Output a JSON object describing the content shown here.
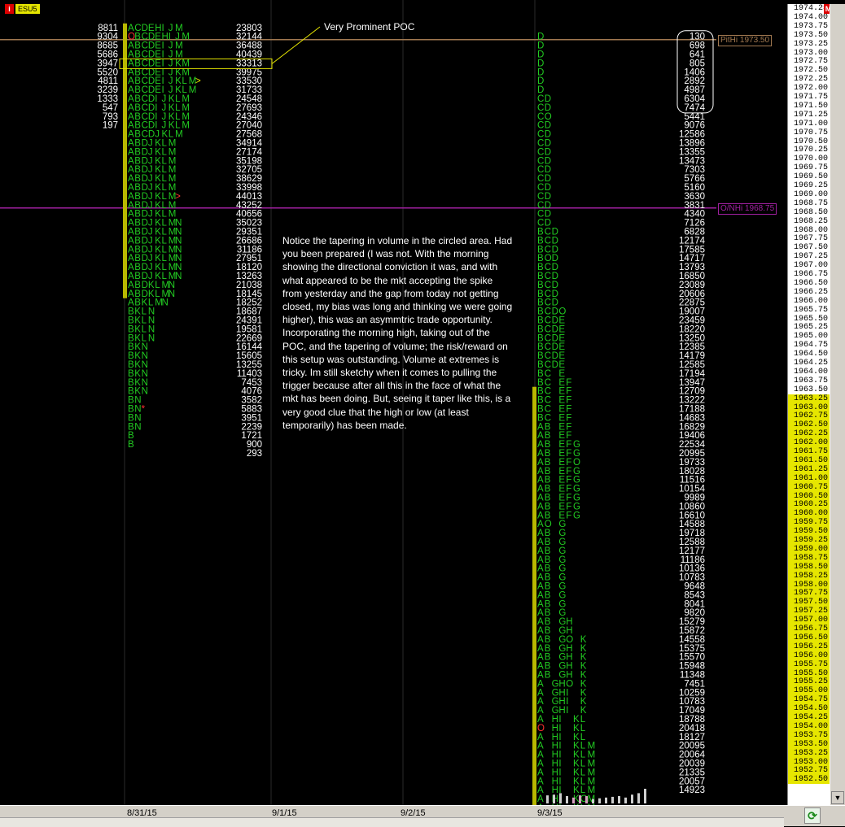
{
  "symbol": {
    "label": "ESU5"
  },
  "annotations": {
    "poc_callout": "Very Prominent POC",
    "note": "Notice the tapering in volume in the circled area. Had you been prepared (I was not. With the morning showing the directional conviction it was, and with what appeared to be the mkt accepting the spike from yesterday and the gap from today not getting closed, my bias was long and thinking we were going higher), this was an asymmtric trade opportunity. Incorporating the morning high, taking out of the POC, and the tapering of volume; the risk/reward on this setup was outstanding. Volume at extremes is tricky. Im still sketchy when it comes to pulling the trigger because after all this in the face of what the mkt has been doing. But, seeing it taper like this, is a very good clue that the high or low (at least temporarily) has been made."
  },
  "levels": {
    "pit_high": {
      "label": "PitHi 1973.50",
      "price": 1973.5,
      "color": "#a07850"
    },
    "overnight_high": {
      "label": "O/NHi 1968.75",
      "price": 1968.75,
      "color": "#a020a0"
    }
  },
  "dates": [
    "8/31/15",
    "9/1/15",
    "9/2/15",
    "9/3/15"
  ],
  "colors": {
    "tpo": "#22cc22",
    "profile_bar": "#b8b800",
    "poc": "#ff3030",
    "text": "#ffffff",
    "callout": "#e6e600"
  },
  "chart_data": {
    "type": "table",
    "price_axis": {
      "top": 1974.25,
      "bottom": 1952.5,
      "step": 0.25,
      "highlight_from": 1963.25
    },
    "profiles": [
      {
        "date": "8/31/15",
        "top_price": 1973.75,
        "poc_price": 1972.75,
        "left_volumes": [
          8811,
          9304,
          8685,
          5686,
          3947,
          5520,
          4811,
          3239,
          1333,
          547,
          793,
          197
        ],
        "tpo_rows": [
          "ACDEHIJM",
          "OBCDEHIJM",
          "ABCDEIJM",
          "ABCDEIJM",
          "ABCDEIJKM",
          "ABCDEIJKM",
          "ABCDEIJKLM>",
          "ABCDEIJKLM",
          "ABCDIJKLM",
          "ABCDIJKLM",
          "ABCDIJKLM",
          "ABCDIJKLM",
          "ABCDJKLM",
          "ABDJKLM",
          "ABDJKLM",
          "ABDJKLM",
          "ABDJKLM",
          "ABDJKLM",
          "ABDJKLM",
          "ABDJKLM>",
          "ABDJKLM",
          "ABDJKLM",
          "ABDJKLMN",
          "ABDJKLMN",
          "ABDJKLMN",
          "ABDJKLMN",
          "ABDJKLMN",
          "ABDJKLMN",
          "ABDJKLMN",
          "ABDKLMN",
          "ABDKLMN",
          "ABKLMN",
          "BKLN",
          "BKLN",
          "BKLN",
          "BKLN",
          "BKN",
          "BKN",
          "BKN",
          "BKN",
          "BKN",
          "BKN",
          "BN",
          "BN*",
          "BN",
          "BN",
          "B",
          "B"
        ],
        "right_volumes": [
          23803,
          32144,
          36488,
          40439,
          33313,
          39975,
          33530,
          31733,
          24548,
          27693,
          24346,
          27040,
          27568,
          34914,
          27174,
          35198,
          32705,
          38629,
          33998,
          44013,
          43252,
          40656,
          35023,
          29351,
          26686,
          31186,
          27951,
          18120,
          13263,
          21038,
          18145,
          18252,
          18687,
          24391,
          19581,
          22669,
          16144,
          15605,
          13255,
          11403,
          7453,
          4076,
          3582,
          5883,
          3951,
          2239,
          1721,
          900,
          293
        ],
        "bar_rows": 31
      },
      {
        "date": "9/3/15",
        "top_price": 1973.5,
        "poc_price": 1955.25,
        "tpo_rows": [
          "D",
          "D",
          "D",
          "D",
          "D",
          "D",
          "D",
          "CD",
          "CD",
          "CO",
          "CD",
          "CD",
          "CD",
          "CD",
          "CD",
          "CD",
          "CD",
          "CD",
          "CD",
          "CD",
          "CD",
          "CD",
          "BCD",
          "BCD",
          "BCD",
          "BOD",
          "BCD",
          "BCD",
          "BCD",
          "BCD",
          "BCD",
          "BCDO",
          "BCDE",
          "BCDE",
          "BCDE",
          "BCDE",
          "BCDE",
          "BCDE",
          "BC E",
          "BC EF",
          "BC EF",
          "BC EF",
          "BC EF",
          "BC EF",
          "AB EF",
          "AB EF",
          "AB EFG",
          "AB EFG",
          "AB EFO",
          "AB EFG",
          "AB EFG",
          "AB EFG",
          "AB EFG",
          "AB EFG",
          "AB EFG",
          "AO G",
          "AB G",
          "AB G",
          "AB G",
          "AB G",
          "AB G",
          "AB G",
          "AB G",
          "AB G",
          "AB G",
          "AB G",
          "AB GH",
          "AB GH",
          "AB GO K",
          "AB GH K",
          "AB GH K",
          "AB GH K",
          "AB GH K",
          "A GHO K",
          "A GHI K",
          "A GHI K",
          "A GHI K",
          "A HI KL",
          "O HI KL",
          "A HI KL",
          "A HI KLM",
          "A HI KLM",
          "A HI KLM",
          "A HI KLM",
          "A HI KLM",
          "A HI KLM",
          "A HI KOM",
          "A HI KLM",
          "A HI KLM",
          "A HIJKLN>"
        ],
        "right_volumes": [
          130,
          698,
          641,
          805,
          1406,
          2892,
          4987,
          6304,
          7474,
          5441,
          9076,
          12586,
          13896,
          13355,
          13473,
          7303,
          5766,
          5160,
          3630,
          3831,
          4340,
          7126,
          6828,
          12174,
          17585,
          14717,
          13793,
          16850,
          23089,
          20606,
          22875,
          19007,
          23459,
          18220,
          13250,
          12385,
          14179,
          12585,
          17194,
          13947,
          12709,
          13222,
          17188,
          14683,
          16829,
          19406,
          22534,
          20995,
          19733,
          18028,
          11516,
          10154,
          9989,
          10860,
          16610,
          14588,
          19718,
          12588,
          12177,
          11186,
          10136,
          10783,
          9648,
          8543,
          8041,
          9820,
          15279,
          15872,
          14558,
          15375,
          15570,
          15948,
          11348,
          7451,
          10259,
          10783,
          17049,
          18788,
          20418,
          18127,
          20095,
          20064,
          20039,
          21335,
          20057,
          14923
        ],
        "bar_start_row": 40,
        "circled_rows": [
          0,
          8
        ]
      }
    ]
  }
}
